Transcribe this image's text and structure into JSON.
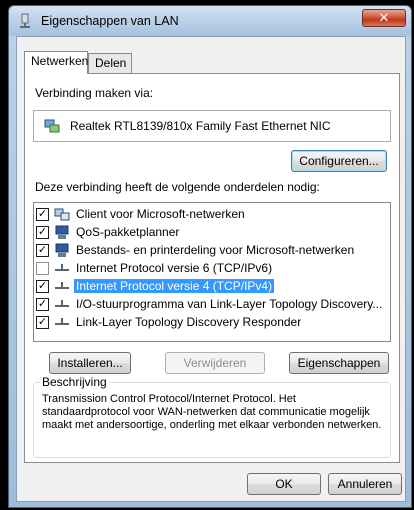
{
  "window": {
    "title": "Eigenschappen van LAN",
    "close_label": "✕"
  },
  "tabs": [
    {
      "label": "Netwerken",
      "active": true
    },
    {
      "label": "Delen",
      "active": false
    }
  ],
  "connect_via": {
    "label": "Verbinding maken via:",
    "adapter": "Realtek RTL8139/810x Family Fast Ethernet NIC",
    "configure_button": "Configureren..."
  },
  "components": {
    "label": "Deze verbinding heeft de volgende onderdelen nodig:",
    "items": [
      {
        "label": "Client voor Microsoft-netwerken",
        "checked": true,
        "icon": "client-icon",
        "selected": false
      },
      {
        "label": "QoS-pakketplanner",
        "checked": true,
        "icon": "service-icon",
        "selected": false
      },
      {
        "label": "Bestands- en printerdeling voor Microsoft-netwerken",
        "checked": true,
        "icon": "service-icon",
        "selected": false
      },
      {
        "label": "Internet Protocol versie 6 (TCP/IPv6)",
        "checked": false,
        "icon": "protocol-icon",
        "selected": false
      },
      {
        "label": "Internet Protocol versie 4 (TCP/IPv4)",
        "checked": true,
        "icon": "protocol-icon",
        "selected": true
      },
      {
        "label": "I/O-stuurprogramma van Link-Layer Topology Discovery...",
        "checked": true,
        "icon": "protocol-icon",
        "selected": false
      },
      {
        "label": "Link-Layer Topology Discovery Responder",
        "checked": true,
        "icon": "protocol-icon",
        "selected": false
      }
    ]
  },
  "actions": {
    "install": "Installeren...",
    "uninstall": "Verwijderen",
    "properties": "Eigenschappen"
  },
  "description": {
    "title": "Beschrijving",
    "text": "Transmission Control Protocol/Internet Protocol. Het standaardprotocol voor WAN-netwerken dat communicatie mogelijk maakt met andersoortige, onderling met elkaar verbonden netwerken."
  },
  "footer": {
    "ok": "OK",
    "cancel": "Annuleren"
  },
  "colors": {
    "selection": "#3399ff",
    "close_button": "#c0351a",
    "titlebar": "#bad0e6"
  }
}
